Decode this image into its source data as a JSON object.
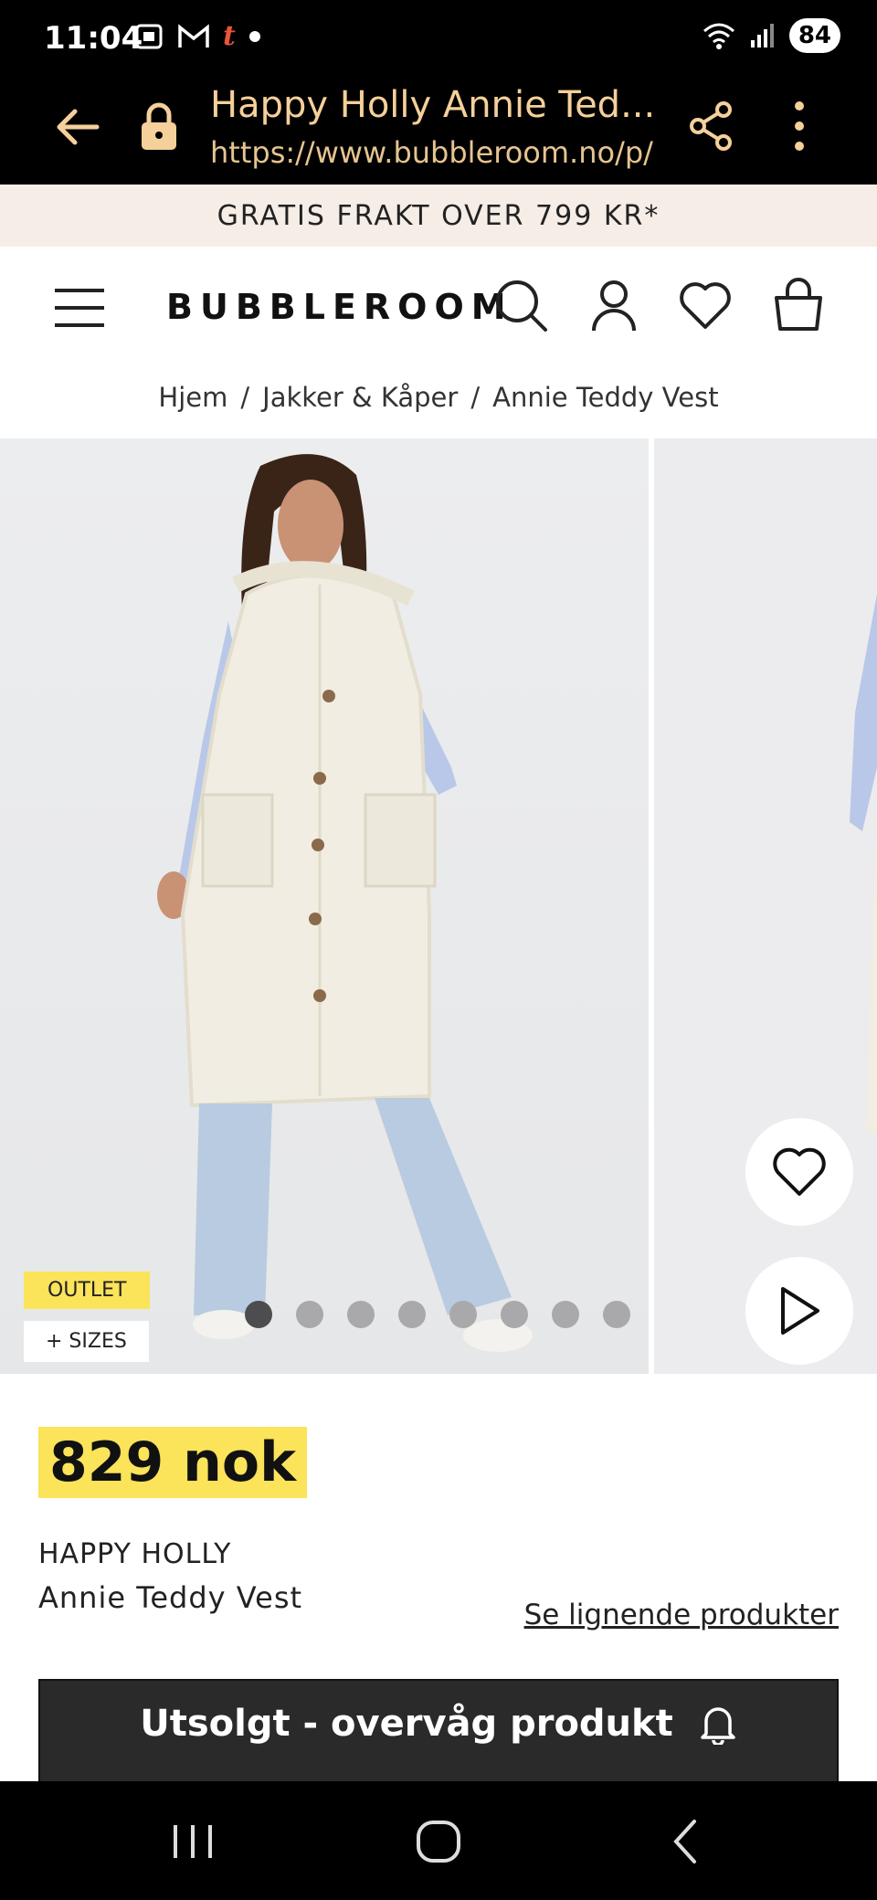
{
  "status_bar": {
    "time": "11:04",
    "battery": "84",
    "icons": [
      "screenshot-icon",
      "gmail-icon",
      "tumblr-icon",
      "dot-icon",
      "wifi-icon",
      "signal-icon"
    ],
    "tumblr_glyph": "t"
  },
  "browser": {
    "title": "Happy Holly Annie Ted...",
    "url": "https://www.bubbleroom.no/p/l"
  },
  "promo": {
    "text": "GRATIS FRAKT OVER 799 KR*"
  },
  "header": {
    "logo": "BUBBLEROOM"
  },
  "breadcrumb": {
    "items": [
      "Hjem",
      "Jakker & Kåper",
      "Annie Teddy Vest"
    ],
    "separator": "/"
  },
  "gallery": {
    "badges": {
      "outlet": "OUTLET",
      "sizes": "+ SIZES"
    },
    "dot_count": 8,
    "active_dot": 0
  },
  "product": {
    "price": "829 nok",
    "brand": "HAPPY HOLLY",
    "name": "Annie Teddy Vest",
    "similar_link": "Se lignende produkter",
    "cta": "Utsolgt - overvåg produkt"
  },
  "colors": {
    "accent_yellow": "#fbe35a",
    "promo_bg": "#f6ede6",
    "browser_text": "#f5d09a",
    "button_dark": "#2a2a2a"
  }
}
